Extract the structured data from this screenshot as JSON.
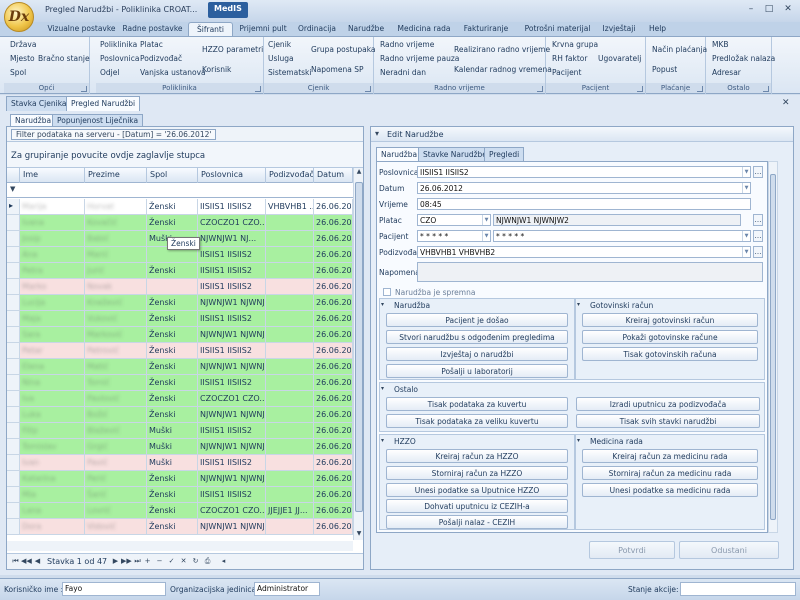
{
  "window": {
    "title": "Pregled Narudžbi - Poliklinika CROAT...",
    "app_name": "MedIS",
    "logo_text": "Dx",
    "min": "–",
    "max": "□",
    "close": "✕"
  },
  "ribbon": {
    "tabs": [
      "Vizualne postavke",
      "Radne postavke",
      "Šifranti",
      "Prijemni pult",
      "Ordinacija",
      "Narudžbe",
      "Medicina rada",
      "Fakturiranje",
      "Potrošni materijal",
      "Izvještaji",
      "Help"
    ],
    "active_tab": "Šifranti",
    "groups": [
      {
        "label": "Opći",
        "items": [
          "Država",
          "Mjesto",
          "Spol",
          "Bračno stanje"
        ]
      },
      {
        "label": "Poliklinika",
        "items": [
          "Poliklinika",
          "Poslovnica",
          "Odjel",
          "Platac",
          "Podizvođač",
          "Vanjska ustanova",
          "HZZO parametri",
          "Korisnik"
        ]
      },
      {
        "label": "Cjenik",
        "items": [
          "Cjenik",
          "Usluga",
          "Sistematski",
          "Grupa postupaka",
          "Napomena SP"
        ]
      },
      {
        "label": "Radno vrijeme",
        "items": [
          "Radno vrijeme",
          "Radno vrijeme pauza",
          "Neradni dan",
          "Realizirano radno vrijeme",
          "Kalendar radnog vremena"
        ]
      },
      {
        "label": "Pacijent",
        "items": [
          "Krvna grupa",
          "RH faktor",
          "Pacijent",
          "Ugovaratelj"
        ]
      },
      {
        "label": "Plaćanje",
        "items": [
          "Način plaćanja",
          "Popust"
        ]
      },
      {
        "label": "Ostalo",
        "items": [
          "MKB",
          "Predložak nalaza",
          "Adresar"
        ]
      }
    ]
  },
  "doc_tabs": [
    "Stavka Cjenika",
    "Pregled Narudžbi"
  ],
  "doc_close": "✕",
  "sub_tabs": [
    "Narudžba",
    "Popunjenost Liječnika"
  ],
  "grid": {
    "filter_text": "Filter podataka na serveru - [Datum] = '26.06.2012'",
    "group_panel_text": "Za grupiranje povucite ovdje zaglavlje stupca",
    "columns": [
      "Ime",
      "Prezime",
      "Spol",
      "Poslovnica",
      "Podizvođač",
      "Datum"
    ],
    "filter_icon": "▼",
    "row_indicator": "▸",
    "rows": [
      {
        "ime": "Marija",
        "prezime": "Horvat",
        "spol": "Ženski",
        "poslovnica": "IISIIS1 IISIIS2",
        "podizvodac": "VHBVHB1 ...",
        "datum": "26.06.2012",
        "color": "#ffffff"
      },
      {
        "ime": "Ivana",
        "prezime": "Kovačić",
        "spol": "Ženski",
        "poslovnica": "CZOCZO1 CZO...",
        "podizvodac": "",
        "datum": "26.06.2012",
        "color": "#a8f0a0"
      },
      {
        "ime": "Josip",
        "prezime": "Babić",
        "spol": "Muški",
        "poslovnica": "NJWNJW1 NJ...",
        "podizvodac": "",
        "datum": "26.06.2012",
        "color": "#a8f0a0"
      },
      {
        "ime": "Ana",
        "prezime": "Marić",
        "spol": "",
        "poslovnica": "IISIIS1 IISIIS2",
        "podizvodac": "",
        "datum": "26.06.2012",
        "color": "#a8f0a0"
      },
      {
        "ime": "Petra",
        "prezime": "Jurić",
        "spol": "Ženski",
        "poslovnica": "IISIIS1 IISIIS2",
        "podizvodac": "",
        "datum": "26.06.2012",
        "color": "#a8f0a0"
      },
      {
        "ime": "Marko",
        "prezime": "Novak",
        "spol": "",
        "poslovnica": "IISIIS1 IISIIS2",
        "podizvodac": "",
        "datum": "26.06.2012",
        "color": "#f8e0e0"
      },
      {
        "ime": "Lucija",
        "prezime": "Knežević",
        "spol": "Ženski",
        "poslovnica": "NJWNJW1 NJWNJW2",
        "podizvodac": "",
        "datum": "26.06.2012",
        "color": "#a8f0a0"
      },
      {
        "ime": "Maja",
        "prezime": "Vuković",
        "spol": "Ženski",
        "poslovnica": "IISIIS1 IISIIS2",
        "podizvodac": "",
        "datum": "26.06.2012",
        "color": "#a8f0a0"
      },
      {
        "ime": "Sara",
        "prezime": "Marković",
        "spol": "Ženski",
        "poslovnica": "NJWNJW1 NJWNJW2",
        "podizvodac": "",
        "datum": "26.06.2012",
        "color": "#a8f0a0"
      },
      {
        "ime": "Petar",
        "prezime": "Petrović",
        "spol": "Ženski",
        "poslovnica": "IISIIS1 IISIIS2",
        "podizvodac": "",
        "datum": "26.06.2012",
        "color": "#f8e0e0"
      },
      {
        "ime": "Elena",
        "prezime": "Matić",
        "spol": "Ženski",
        "poslovnica": "NJWNJW1 NJWNJW2",
        "podizvodac": "",
        "datum": "26.06.2012",
        "color": "#a8f0a0"
      },
      {
        "ime": "Nina",
        "prezime": "Tomić",
        "spol": "Ženski",
        "poslovnica": "IISIIS1 IISIIS2",
        "podizvodac": "",
        "datum": "26.06.2012",
        "color": "#a8f0a0"
      },
      {
        "ime": "Iva",
        "prezime": "Pavlović",
        "spol": "Ženski",
        "poslovnica": "CZOCZO1 CZO...",
        "podizvodac": "",
        "datum": "26.06.2012",
        "color": "#a8f0a0"
      },
      {
        "ime": "Luka",
        "prezime": "Božić",
        "spol": "Ženski",
        "poslovnica": "NJWNJW1 NJWNJW2",
        "podizvodac": "",
        "datum": "26.06.2012",
        "color": "#a8f0a0"
      },
      {
        "ime": "Filip",
        "prezime": "Blažević",
        "spol": "Muški",
        "poslovnica": "IISIIS1 IISIIS2",
        "podizvodac": "",
        "datum": "26.06.2012",
        "color": "#a8f0a0"
      },
      {
        "ime": "Tomislav",
        "prezime": "Grgić",
        "spol": "Muški",
        "poslovnica": "NJWNJW1 NJWNJW2",
        "podizvodac": "",
        "datum": "26.06.2012",
        "color": "#a8f0a0"
      },
      {
        "ime": "Ivan",
        "prezime": "Pavić",
        "spol": "Muški",
        "poslovnica": "IISIIS1 IISIIS2",
        "podizvodac": "",
        "datum": "26.06.2012",
        "color": "#f8e0e0"
      },
      {
        "ime": "Katarina",
        "prezime": "Perić",
        "spol": "Ženski",
        "poslovnica": "NJWNJW1 NJWNJW2",
        "podizvodac": "",
        "datum": "26.06.2012",
        "color": "#a8f0a0"
      },
      {
        "ime": "Mia",
        "prezime": "Šarić",
        "spol": "Ženski",
        "poslovnica": "IISIIS1 IISIIS2",
        "podizvodac": "",
        "datum": "26.06.2012",
        "color": "#a8f0a0"
      },
      {
        "ime": "Lana",
        "prezime": "Lovrić",
        "spol": "Ženski",
        "poslovnica": "CZOCZO1 CZO...",
        "podizvodac": "JJEJJE1 JJ...",
        "datum": "26.06.2012",
        "color": "#a8f0a0"
      },
      {
        "ime": "Dora",
        "prezime": "Vidović",
        "spol": "Ženski",
        "poslovnica": "NJWNJW1 NJWNJW2",
        "podizvodac": "",
        "datum": "26.06.2012",
        "color": "#f8e0e0"
      }
    ],
    "tooltip": "Ženski",
    "nav_text": "Stavka 1 od 47",
    "nav_buttons": [
      "⏮",
      "◀◀",
      "◀",
      "▶",
      "▶▶",
      "⏭",
      "+",
      "−",
      "✓",
      "✕",
      "↻",
      "⎙",
      "◂"
    ]
  },
  "edit": {
    "header": "Edit Narudžbe",
    "toggle": "▾",
    "tabs": [
      "Narudžba",
      "Stavke Narudžbe",
      "Pregledi"
    ],
    "fields": {
      "poslovnica_label": "Poslovnica",
      "poslovnica": "IISIIS1 IISIIS2",
      "datum_label": "Datum",
      "datum": "26.06.2012",
      "vrijeme_label": "Vrijeme",
      "vrijeme": "08:45",
      "platac_label": "Platac",
      "platac_code": "CZO",
      "platac_name": "NJWNJW1 NJWNJW2",
      "pacijent_label": "Pacijent",
      "pacijent_a": "* * * * *",
      "pacijent_b": "* * * * *",
      "podizvodac_label": "Podizvođač",
      "podizvodac": "VHBVHB1 VHBVHB2",
      "napomena_label": "Napomena",
      "napomena": "",
      "sprema_label": "Narudžba je spremna",
      "ellipsis": "…",
      "dd": "▼"
    },
    "sections": {
      "narudzba": {
        "title": "Narudžba",
        "buttons": [
          "Pacijent je došao",
          "Stvori narudžbu s odgođenim pregledima",
          "Izvještaj o narudžbi",
          "Pošalji u laboratorij"
        ]
      },
      "gotovinski": {
        "title": "Gotovinski račun",
        "buttons": [
          "Kreiraj gotovinski račun",
          "Pokaži gotovinske račune",
          "Tisak gotovinskih računa"
        ]
      },
      "ostalo": {
        "title": "Ostalo",
        "buttons": [
          "Tisak podataka za kuvertu",
          "Tisak podataka za veliku kuvertu",
          "Izradi uputnicu za podizvođača",
          "Tisak svih stavki narudžbi"
        ]
      },
      "hzzo": {
        "title": "HZZO",
        "buttons": [
          "Kreiraj račun za HZZO",
          "Storniraj račun za HZZO",
          "Unesi podatke sa Uputnice HZZO",
          "Dohvati uputnicu iz CEZIH-a",
          "Pošalji nalaz - CEZIH"
        ]
      },
      "medicina": {
        "title": "Medicina rada",
        "buttons": [
          "Kreiraj račun za medicinu rada",
          "Storniraj račun za medicinu rada",
          "Unesi podatke sa medicinu rada"
        ]
      }
    },
    "potvrdi": "Potvrdi",
    "odustani": "Odustani"
  },
  "status": {
    "korisnicko_label": "Korisničko ime :",
    "korisnicko_value": "Fayo",
    "org_label": "Organizacijska jedinica :",
    "org_value": "Administrator",
    "stanje_label": "Stanje akcije:",
    "stanje_value": ""
  }
}
